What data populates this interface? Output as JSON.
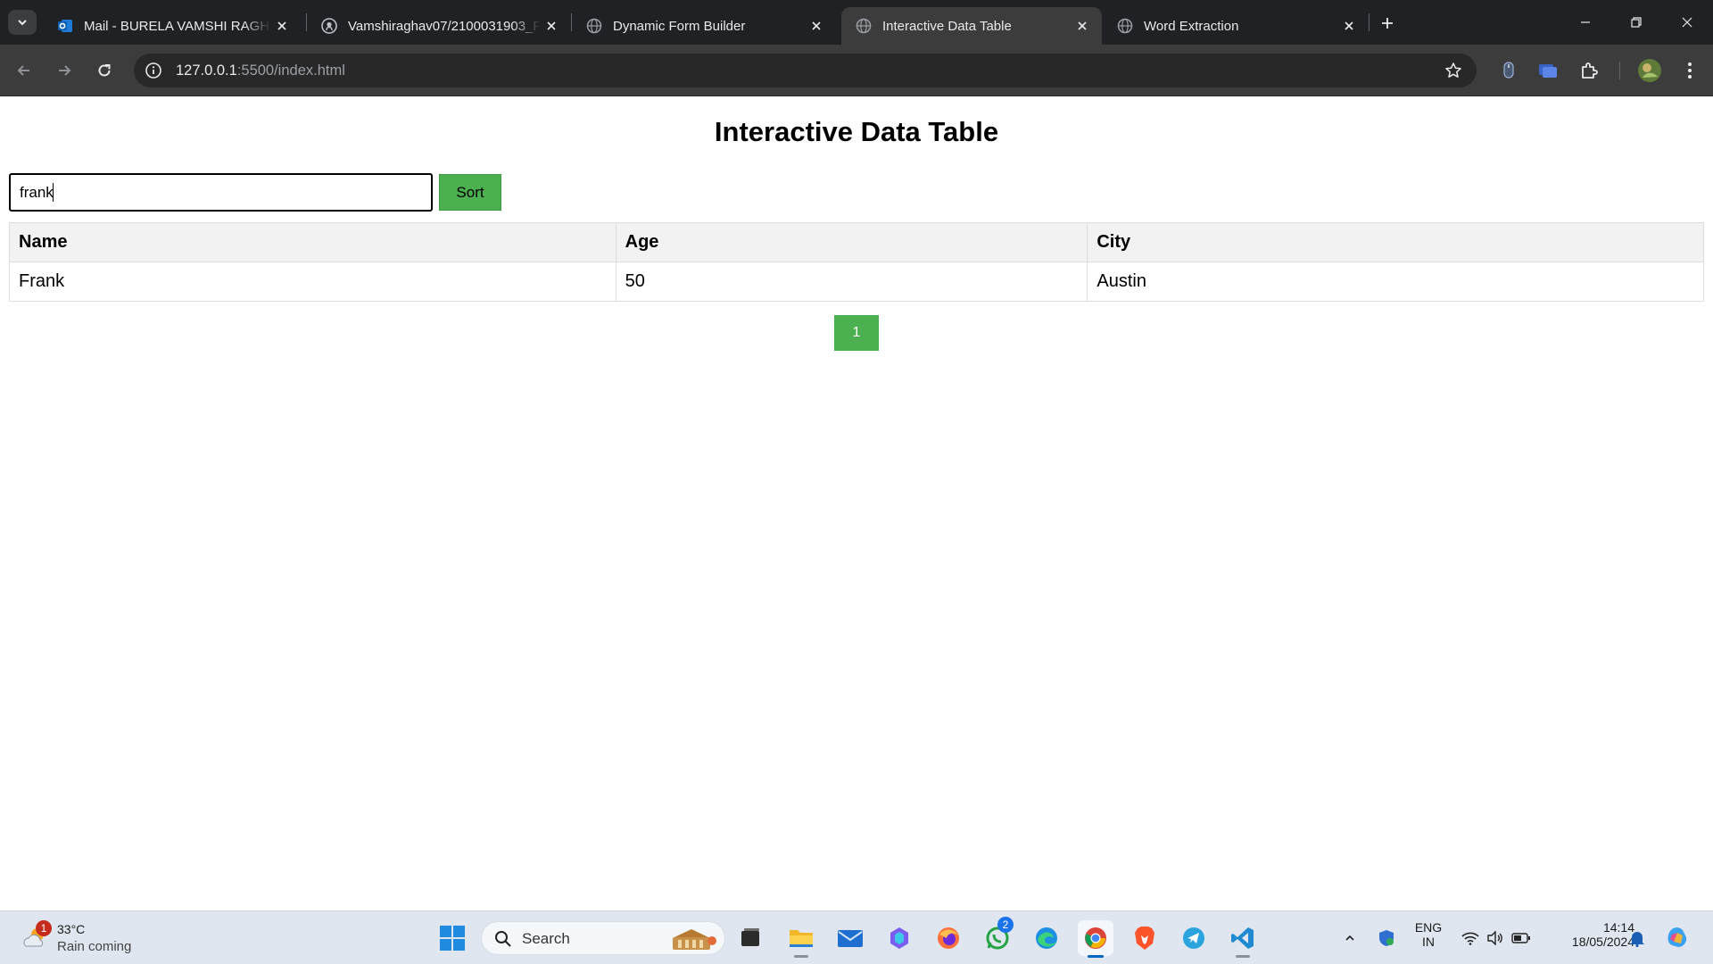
{
  "browser": {
    "tabs": [
      {
        "title": "Mail - BURELA VAMSHI RAGHAV",
        "favicon": "outlook-icon",
        "active": false
      },
      {
        "title": "Vamshiraghav07/2100031903_F",
        "favicon": "github-icon",
        "active": false
      },
      {
        "title": "Dynamic Form Builder",
        "favicon": "globe-icon",
        "active": false
      },
      {
        "title": "Interactive Data Table",
        "favicon": "globe-icon",
        "active": true
      },
      {
        "title": "Word Extraction",
        "favicon": "globe-icon",
        "active": false
      }
    ],
    "url_host": "127.0.0.1",
    "url_rest": ":5500/index.html"
  },
  "page": {
    "title": "Interactive Data Table",
    "search_value": "frank",
    "sort_label": "Sort",
    "table": {
      "headers": [
        "Name",
        "Age",
        "City"
      ],
      "rows": [
        [
          "Frank",
          "50",
          "Austin"
        ]
      ]
    },
    "pagination": [
      "1"
    ],
    "accent_color": "#4caf50"
  },
  "taskbar": {
    "weather": {
      "temp": "33°C",
      "condition": "Rain coming",
      "badge": "1"
    },
    "search_label": "Search",
    "whatsapp_badge": "2",
    "lang_top": "ENG",
    "lang_bottom": "IN",
    "time": "14:14",
    "date": "18/05/2024"
  }
}
